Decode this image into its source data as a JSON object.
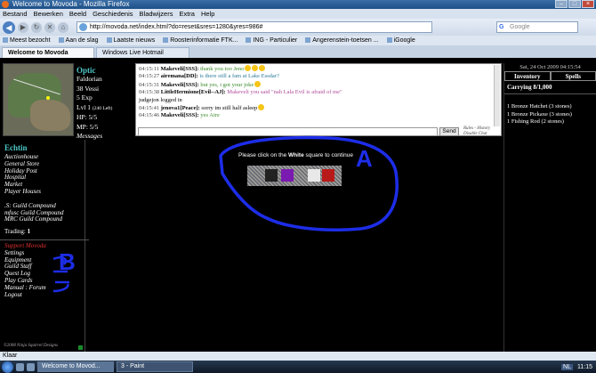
{
  "browser": {
    "window_title": "Welcome to Movoda - Mozilla Firefox",
    "menu": [
      "Bestand",
      "Bewerken",
      "Beeld",
      "Geschiedenis",
      "Bladwijzers",
      "Extra",
      "Help"
    ],
    "url": "http://movoda.net/index.html?do=reset&sres=1280&yres=986#",
    "search_placeholder": "Google",
    "search_engine": "G",
    "bookmarks": [
      "Meest bezocht",
      "Aan de slag",
      "Laatste nieuws",
      "Roosterinformatie FTK...",
      "ING - Particulier",
      "Angerenstein-toetsen ...",
      "iGoogle"
    ],
    "tabs": [
      {
        "label": "Welcome to Movoda",
        "active": true
      },
      {
        "label": "Windows Live Hotmail",
        "active": false
      }
    ],
    "status": "Klaar"
  },
  "character": {
    "name": "Optic",
    "location": "Faldorian",
    "vessi": "38 Vessi",
    "exp": "5 Exp",
    "level": "Lvl 1",
    "level_left": "(240 Left)",
    "hp": "HP: 5/5",
    "mp": "MP: 5/5",
    "messages": "Messages"
  },
  "chat": {
    "lines": [
      {
        "time": "04:15:11",
        "user": "Makeveli[SSS]:",
        "text": "thank you too Jeno",
        "color": "gr",
        "emotes": 3
      },
      {
        "time": "04:15:27",
        "user": "airemana[DD]:",
        "text": "is there still a fam at Lake Essdar?",
        "color": "cy",
        "emotes": 0
      },
      {
        "time": "04:15:31",
        "user": "Makeveli[SSS]:",
        "text": "but yes, i got your joke",
        "color": "gr",
        "emotes": 1
      },
      {
        "time": "04:15:38",
        "user": "LittleHermione[Evil--AJ]:",
        "text": "Makeveli you said \"nah Lala Evil is afraid of me\"",
        "color": "pk",
        "emotes": 0
      },
      {
        "time": "",
        "user": "",
        "text": "judgejon logged in",
        "color": "",
        "emotes": 0
      },
      {
        "time": "04:15:41",
        "user": "jenova1[Peace]:",
        "text": "sorry im still half asleep",
        "color": "",
        "emotes": 1
      },
      {
        "time": "04:15:46",
        "user": "Makeveli[SSS]:",
        "text": "yes Aire",
        "color": "gr",
        "emotes": 0
      }
    ],
    "send_label": "Send",
    "rules_link": "Rules - History",
    "disable_link": "Disable Chat"
  },
  "right_panel": {
    "datetime": "Sat, 24 Oct 2009 04:15:54",
    "tab_inventory": "Inventory",
    "tab_spells": "Spells",
    "carrying": "Carrying 8/1,000",
    "items": [
      "1 Bronze Hatchet (3 stones)",
      "1 Bronze Pickaxe (3 stones)",
      "1 Fishing Rod (2 stones)"
    ]
  },
  "left_nav": {
    "location_title": "Echtin",
    "places": [
      "Auctionhouse",
      "General Store",
      "Holiday Post",
      "Hospital",
      "Market",
      "Player Houses"
    ],
    "guilds": [
      ".S: Guild Compound",
      "mfusc Guild Compound",
      "MRC Guild Compound"
    ],
    "trading_label": "Trading:",
    "trading_value": "1",
    "support": "Support Movoda",
    "links": [
      "Settings",
      "Equipment",
      "Guild Staff",
      "Quest Log",
      "Play Cards",
      "Manual : Forum",
      "Logout"
    ],
    "footer": "©2008 Ninja Squirrel Designs"
  },
  "main": {
    "prompt_before": "Please click on the",
    "prompt_bold": "White",
    "prompt_after": "square to continue",
    "annotation_a": "A",
    "annotation_b": "B",
    "annotation_color": "#1d2de8"
  },
  "taskbar": {
    "buttons": [
      "Welcome to Movod...",
      "3 - Paint"
    ],
    "lang": "NL",
    "clock": "11:15"
  }
}
